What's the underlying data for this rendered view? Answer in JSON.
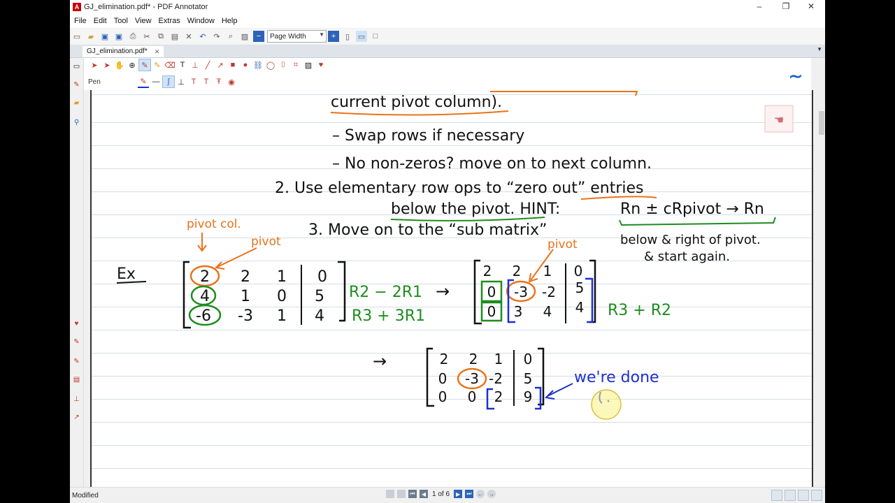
{
  "window": {
    "title": "GJ_elimination.pdf* - PDF Annotator",
    "controls": {
      "minimize": "‒",
      "maximize": "❐",
      "close": "✕"
    }
  },
  "menu": [
    "File",
    "Edit",
    "Tool",
    "View",
    "Extras",
    "Window",
    "Help"
  ],
  "toolbar": {
    "zoom_value": "Page Width"
  },
  "tab": {
    "label": "GJ_elimination.pdf*"
  },
  "annotation_bar": {
    "tool_label": "Pen"
  },
  "page_content": {
    "top_fragment": "current pivot column).",
    "bullet1": "– Swap rows if necessary",
    "bullet2": "– No non-zeros? move on to next column.",
    "step2_line1": "2. Use elementary row ops to “zero out” entries",
    "step2_line2": "below the pivot. HINT:",
    "hint_formula": "Rn ± cRpivot → Rn",
    "pivot_col_label": "pivot col.",
    "pivot_label": "pivot",
    "pivot_label2": "pivot",
    "step3": "3. Move on to the “sub matrix”",
    "step3_cont1": "below & right of pivot.",
    "step3_cont2": "& start again.",
    "ex_label": "Ex",
    "matrix1": [
      [
        "2",
        "2",
        "1",
        "0"
      ],
      [
        "4",
        "1",
        "0",
        "5"
      ],
      [
        "-6",
        "-3",
        "1",
        "4"
      ]
    ],
    "ops1_line1": "R2 − 2R1",
    "ops1_line2": "R3 + 3R1",
    "arrow1": "→",
    "matrix2": [
      [
        "2",
        "2",
        "1",
        "0"
      ],
      [
        "0",
        "-3",
        "-2",
        "5"
      ],
      [
        "0",
        "3",
        "4",
        "4"
      ]
    ],
    "ops2": "R3 + R2",
    "arrow2": "→",
    "matrix3": [
      [
        "2",
        "2",
        "1",
        "0"
      ],
      [
        "0",
        "-3",
        "-2",
        "5"
      ],
      [
        "0",
        "0",
        "2",
        "9"
      ]
    ],
    "done_text": "we're done"
  },
  "status": {
    "state": "Modified",
    "page_indicator": "1 of 6"
  },
  "colors": {
    "orange": "#e8731a",
    "green": "#1e8c1e",
    "blue": "#1d2fd0",
    "ink": "#111111"
  }
}
